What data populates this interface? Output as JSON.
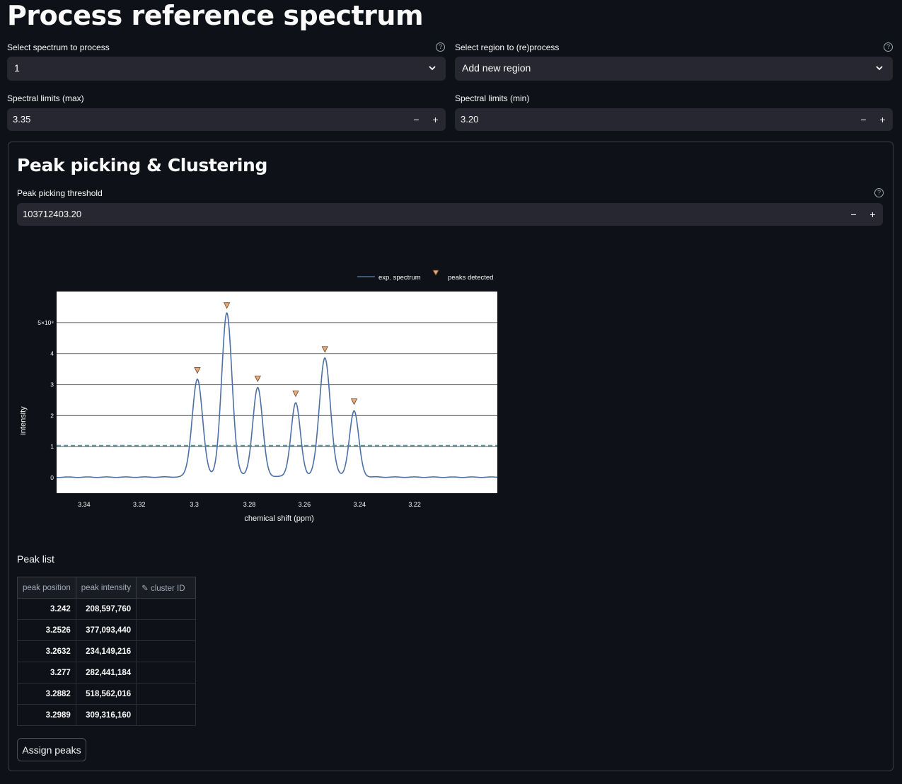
{
  "page": {
    "title": "Process reference spectrum"
  },
  "spectrum_select": {
    "label": "Select spectrum to process",
    "value": "1"
  },
  "region_select": {
    "label": "Select region to (re)process",
    "value": "Add new region"
  },
  "limit_max": {
    "label": "Spectral limits (max)",
    "value": "3.35"
  },
  "limit_min": {
    "label": "Spectral limits (min)",
    "value": "3.20"
  },
  "section": {
    "title": "Peak picking & Clustering"
  },
  "threshold": {
    "label": "Peak picking threshold",
    "value": "103712403.20"
  },
  "stepper": {
    "minus": "−",
    "plus": "+"
  },
  "chart_data": {
    "type": "line",
    "title": "",
    "xlabel": "chemical shift (ppm)",
    "ylabel": "intensity",
    "xlim": [
      3.35,
      3.19
    ],
    "ylim": [
      -50000000,
      600000000
    ],
    "x_reversed": true,
    "x_ticks": [
      "3.34",
      "3.32",
      "3.3",
      "3.28",
      "3.26",
      "3.24",
      "3.22"
    ],
    "x_tick_values": [
      3.34,
      3.32,
      3.3,
      3.28,
      3.26,
      3.24,
      3.22
    ],
    "y_ticks": [
      "0",
      "1",
      "2",
      "3",
      "4",
      "5×10⁸"
    ],
    "y_tick_values": [
      0,
      100000000,
      200000000,
      300000000,
      400000000,
      500000000
    ],
    "legend": {
      "placement": "top",
      "entries": [
        "exp. spectrum",
        "peaks detected"
      ]
    },
    "threshold": 103712403.2,
    "series": [
      {
        "name": "exp. spectrum",
        "type": "line",
        "color": "#4c6fa5"
      },
      {
        "name": "peaks detected",
        "type": "scatter",
        "marker": "triangle-down",
        "color": "#e8a878",
        "x": [
          3.242,
          3.2526,
          3.2632,
          3.277,
          3.2882,
          3.2989
        ],
        "y": [
          208597760,
          377093440,
          234149216,
          282441184,
          518562016,
          309316160
        ]
      }
    ],
    "grid": true
  },
  "peak_list": {
    "title": "Peak list",
    "columns": [
      "peak position",
      "peak intensity",
      "cluster ID"
    ],
    "rows": [
      [
        "3.242",
        "208,597,760",
        ""
      ],
      [
        "3.2526",
        "377,093,440",
        ""
      ],
      [
        "3.2632",
        "234,149,216",
        ""
      ],
      [
        "3.277",
        "282,441,184",
        ""
      ],
      [
        "3.2882",
        "518,562,016",
        ""
      ],
      [
        "3.2989",
        "309,316,160",
        ""
      ]
    ]
  },
  "assign_button": {
    "label": "Assign peaks"
  },
  "colors": {
    "background": "#0e1117",
    "input_bg": "#262730",
    "line": "#4c6fa5",
    "marker": "#e8a878",
    "threshold": "#5a9aa0"
  },
  "icons": {
    "help": "help-circle-icon",
    "chevron": "chevron-down-icon",
    "edit": "edit-column-icon"
  }
}
